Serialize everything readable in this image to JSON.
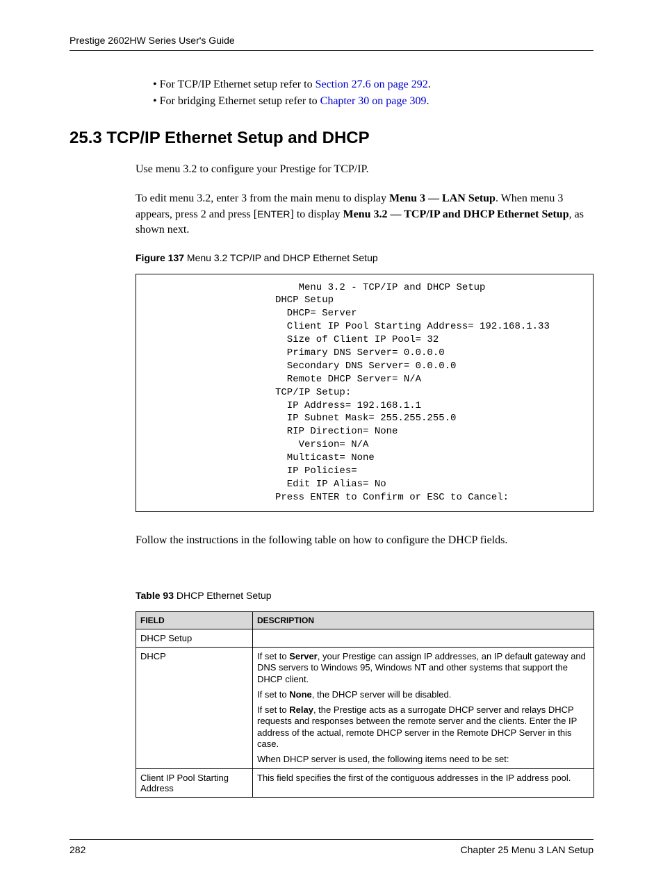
{
  "header": {
    "guide": "Prestige 2602HW Series User's Guide"
  },
  "bullets": {
    "tcpip_prefix": "For TCP/IP Ethernet setup refer to ",
    "tcpip_link": "Section 27.6 on page 292",
    "tcpip_suffix": ".",
    "bridge_prefix": "For bridging Ethernet setup refer to ",
    "bridge_link": "Chapter 30 on page 309",
    "bridge_suffix": "."
  },
  "section": {
    "heading": "25.3  TCP/IP Ethernet Setup and DHCP"
  },
  "paras": {
    "p1": "Use menu 3.2 to configure your Prestige for TCP/IP.",
    "p2a": "To edit menu 3.2, enter 3 from the main menu to display ",
    "p2b": "Menu 3 — LAN Setup",
    "p2c": ". When menu 3 appears, press 2 and press [",
    "p2d": "ENTER",
    "p2e": "] to display ",
    "p2f": "Menu 3.2 — TCP/IP and DHCP Ethernet Setup",
    "p2g": ", as shown next.",
    "p3": "Follow the instructions in the following table on how to configure the DHCP fields."
  },
  "figure": {
    "num": "Figure 137",
    "title": "   Menu 3.2 TCP/IP and DHCP Ethernet Setup"
  },
  "code": "    Menu 3.2 - TCP/IP and DHCP Setup\nDHCP Setup\n  DHCP= Server\n  Client IP Pool Starting Address= 192.168.1.33\n  Size of Client IP Pool= 32\n  Primary DNS Server= 0.0.0.0\n  Secondary DNS Server= 0.0.0.0\n  Remote DHCP Server= N/A\nTCP/IP Setup:\n  IP Address= 192.168.1.1\n  IP Subnet Mask= 255.255.255.0\n  RIP Direction= None\n    Version= N/A\n  Multicast= None\n  IP Policies=\n  Edit IP Alias= No\nPress ENTER to Confirm or ESC to Cancel:",
  "table": {
    "num": "Table 93",
    "title": "   DHCP Ethernet Setup",
    "h1": "Field",
    "h2": "Description",
    "r1f": "DHCP Setup",
    "r1d": "",
    "r2f": "DHCP",
    "r2p1a": "If set to ",
    "r2p1b": "Server",
    "r2p1c": ", your Prestige can assign IP addresses, an IP default gateway and DNS servers to Windows 95, Windows NT and other systems that support the DHCP client.",
    "r2p2a": "If set to ",
    "r2p2b": "None",
    "r2p2c": ", the DHCP server will be disabled.",
    "r2p3a": "If set to ",
    "r2p3b": "Relay",
    "r2p3c": ", the Prestige acts as a surrogate DHCP server and relays DHCP requests and responses between the remote server and the clients. Enter the IP address of the actual, remote DHCP server in the Remote DHCP Server in this case.",
    "r2p4": "When DHCP server is used, the following items need to be set:",
    "r3f": "Client IP Pool Starting Address",
    "r3d": "This field specifies the first of the contiguous addresses in the IP address pool."
  },
  "footer": {
    "page": "282",
    "chapter": "Chapter 25 Menu 3 LAN Setup"
  }
}
